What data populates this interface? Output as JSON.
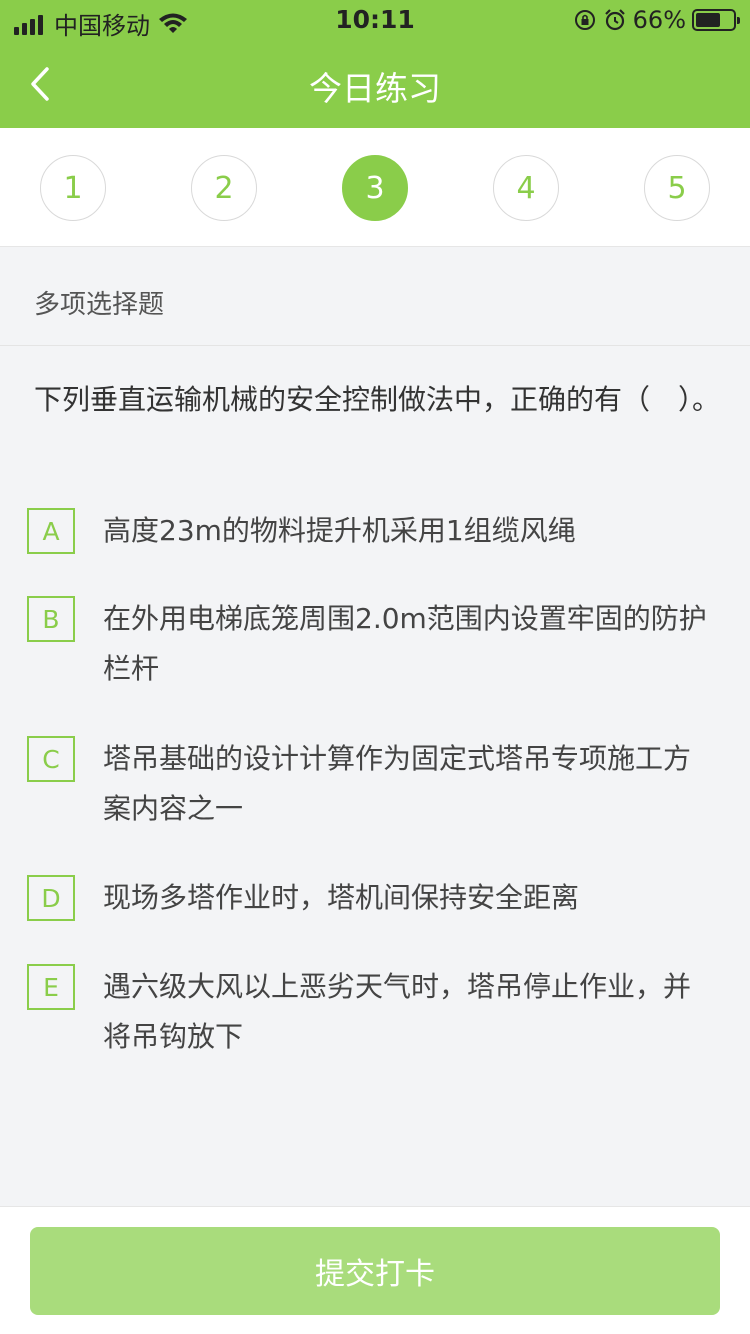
{
  "status_bar": {
    "carrier": "中国移动",
    "time": "10:11",
    "battery": "66%",
    "battery_level": 0.66
  },
  "nav": {
    "title": "今日练习",
    "back_icon": "chevron-left-icon"
  },
  "steps": {
    "items": [
      "1",
      "2",
      "3",
      "4",
      "5"
    ],
    "active_index": 2
  },
  "question": {
    "type": "多项选择题",
    "text": "下列垂直运输机械的安全控制做法中，正确的有（　）。",
    "options": [
      {
        "letter": "A",
        "text": "高度23m的物料提升机采用1组缆风绳"
      },
      {
        "letter": "B",
        "text": "在外用电梯底笼周围2.0m范围内设置牢固的防护栏杆"
      },
      {
        "letter": "C",
        "text": "塔吊基础的设计计算作为固定式塔吊专项施工方案内容之一"
      },
      {
        "letter": "D",
        "text": "现场多塔作业时，塔机间保持安全距离"
      },
      {
        "letter": "E",
        "text": "遇六级大风以上恶劣天气时，塔吊停止作业，并将吊钩放下"
      }
    ]
  },
  "submit": {
    "label": "提交打卡"
  },
  "colors": {
    "accent": "#8acd4a",
    "submit_disabled": "#a9dc7c"
  }
}
